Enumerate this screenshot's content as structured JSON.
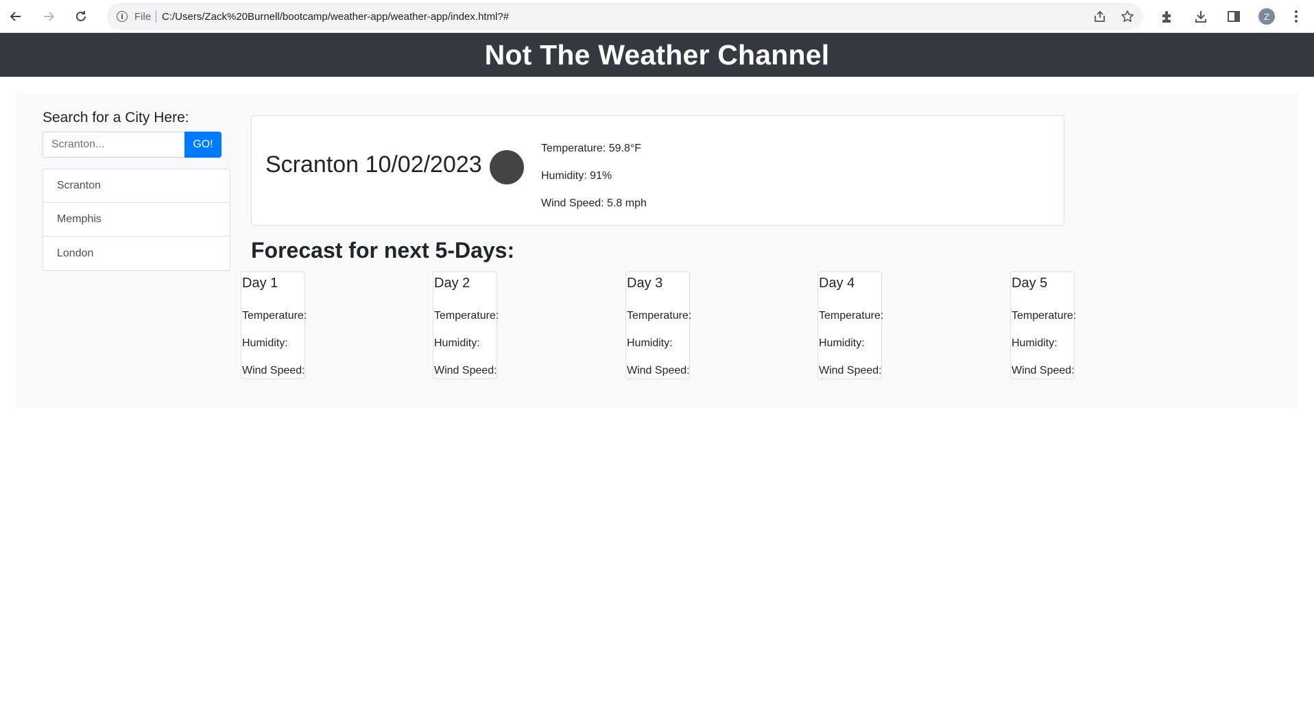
{
  "browser": {
    "file_label": "File",
    "url": "C:/Users/Zack%20Burnell/bootcamp/weather-app/weather-app/index.html?#",
    "profile_initial": "Z",
    "icons": [
      "back-arrow-icon",
      "forward-arrow-icon",
      "reload-icon",
      "info-icon",
      "share-icon",
      "star-icon",
      "extensions-icon",
      "download-icon",
      "side-panel-icon",
      "profile-avatar",
      "more-menu-icon"
    ]
  },
  "header": {
    "title": "Not The Weather Channel"
  },
  "search": {
    "label": "Search for a City Here:",
    "placeholder": "Scranton...",
    "value": "",
    "button_label": "GO!"
  },
  "history": {
    "cities": [
      "Scranton",
      "Memphis",
      "London"
    ]
  },
  "current": {
    "title": "Scranton 10/02/2023",
    "temperature": "Temperature: 59.8°F",
    "humidity": "Humidity: 91%",
    "wind": "Wind Speed: 5.8 mph"
  },
  "forecast": {
    "heading": "Forecast for next 5-Days:",
    "days": [
      {
        "label": "Day 1",
        "temperature": "Temperature:",
        "humidity": "Humidity:",
        "wind": "Wind Speed:"
      },
      {
        "label": "Day 2",
        "temperature": "Temperature:",
        "humidity": "Humidity:",
        "wind": "Wind Speed:"
      },
      {
        "label": "Day 3",
        "temperature": "Temperature:",
        "humidity": "Humidity:",
        "wind": "Wind Speed:"
      },
      {
        "label": "Day 4",
        "temperature": "Temperature:",
        "humidity": "Humidity:",
        "wind": "Wind Speed:"
      },
      {
        "label": "Day 5",
        "temperature": "Temperature:",
        "humidity": "Humidity:",
        "wind": "Wind Speed:"
      }
    ]
  },
  "colors": {
    "header_bg": "#343a40",
    "primary_button": "#007bff",
    "container_bg": "#f8f9fa",
    "weather_icon": "#444444"
  }
}
